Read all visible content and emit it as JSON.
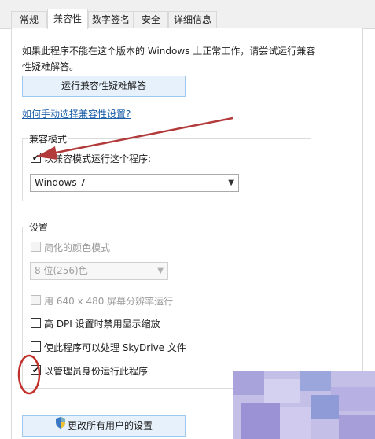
{
  "tabs": [
    {
      "label": "常规"
    },
    {
      "label": "兼容性",
      "active": true
    },
    {
      "label": "数字签名"
    },
    {
      "label": "安全"
    },
    {
      "label": "详细信息"
    }
  ],
  "intro_text": "如果此程序不能在这个版本的 Windows 上正常工作，请尝试运行兼容性疑难解答。",
  "troubleshooter_button": "运行兼容性疑难解答",
  "manual_link": "如何手动选择兼容性设置?",
  "compat_mode": {
    "title": "兼容模式",
    "checkbox_label": "以兼容模式运行这个程序:",
    "checked": true,
    "os_selected": "Windows 7"
  },
  "settings": {
    "title": "设置",
    "reduced_color": {
      "label": "简化的颜色模式",
      "checked": false,
      "disabled": true
    },
    "color_select": "8 位(256)色",
    "res640": {
      "label": "用 640 x 480 屏幕分辨率运行",
      "checked": false,
      "disabled": true
    },
    "high_dpi": {
      "label": "高 DPI 设置时禁用显示缩放",
      "checked": false
    },
    "skydrive": {
      "label": "使此程序可以处理 SkyDrive 文件",
      "checked": false
    },
    "admin": {
      "label": "以管理员身份运行此程序",
      "checked": true
    }
  },
  "change_all_button": "更改所有用户的设置",
  "check_glyph": "✔",
  "colors": {
    "arrow": "#b23a3a",
    "circle": "#c0302a",
    "link": "#1a5ea8",
    "button_border": "#9ec9ef"
  }
}
